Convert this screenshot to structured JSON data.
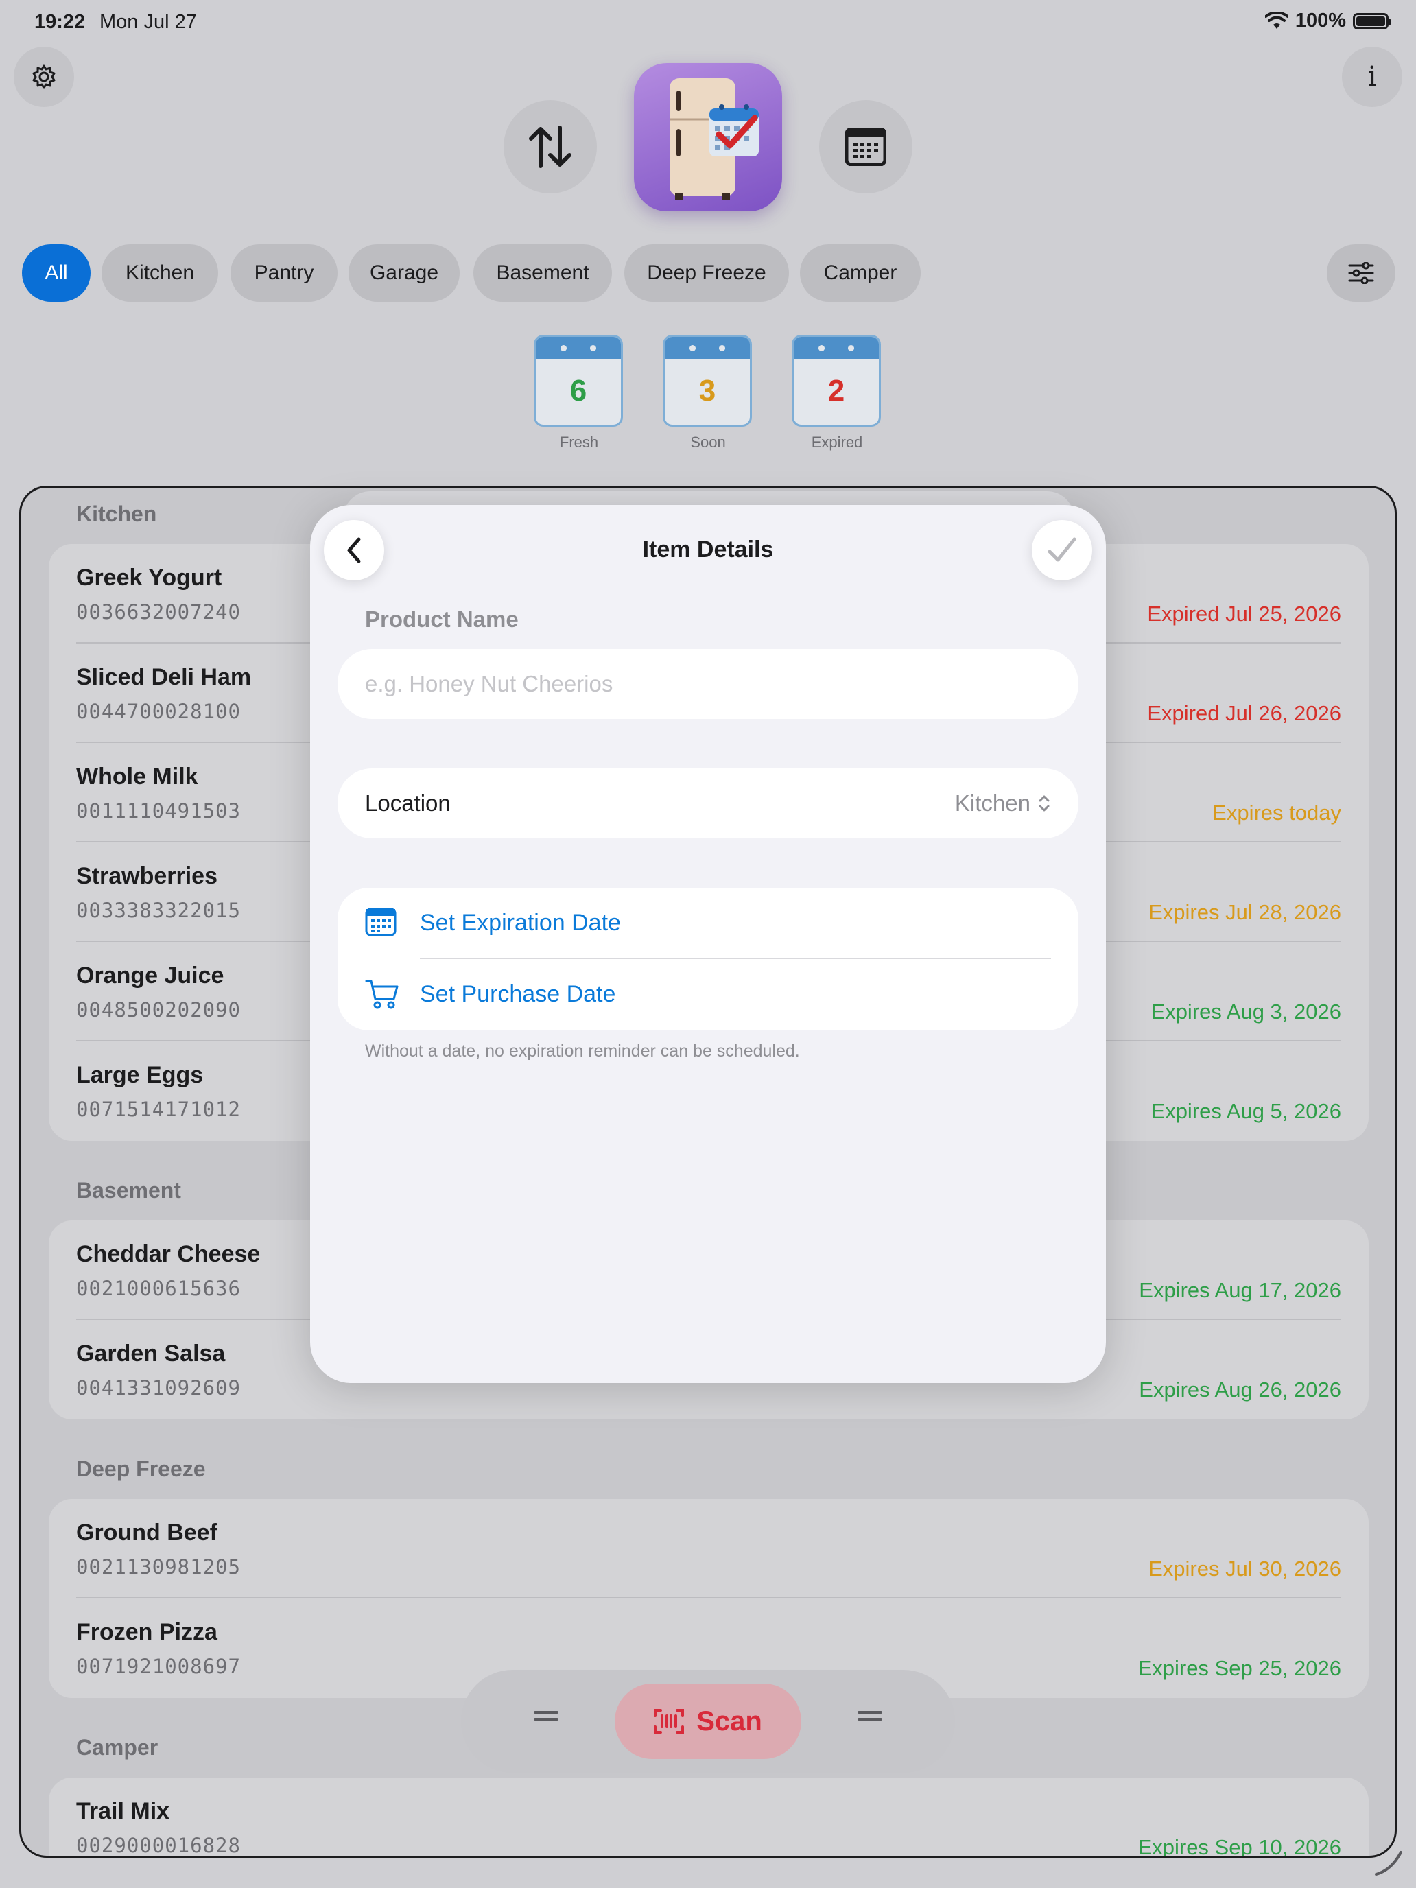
{
  "status": {
    "time": "19:22",
    "date": "Mon Jul 27",
    "battery": "100%"
  },
  "filters": [
    "All",
    "Kitchen",
    "Pantry",
    "Garage",
    "Basement",
    "Deep Freeze",
    "Camper"
  ],
  "stats": [
    {
      "value": "6",
      "label": "Fresh",
      "color": "#2e9e48"
    },
    {
      "value": "3",
      "label": "Soon",
      "color": "#d89a1c"
    },
    {
      "value": "2",
      "label": "Expired",
      "color": "#d6302a"
    }
  ],
  "sections": [
    {
      "title": "Kitchen",
      "items": [
        {
          "name": "Greek Yogurt",
          "code": "0036632007240",
          "expiry": "Expired Jul 25, 2026",
          "status": "red"
        },
        {
          "name": "Sliced Deli Ham",
          "code": "0044700028100",
          "expiry": "Expired Jul 26, 2026",
          "status": "red"
        },
        {
          "name": "Whole Milk",
          "code": "0011110491503",
          "expiry": "Expires today",
          "status": "orange"
        },
        {
          "name": "Strawberries",
          "code": "0033383322015",
          "expiry": "Expires Jul 28, 2026",
          "status": "orange"
        },
        {
          "name": "Orange Juice",
          "code": "0048500202090",
          "expiry": "Expires Aug 3, 2026",
          "status": "green"
        },
        {
          "name": "Large Eggs",
          "code": "0071514171012",
          "expiry": "Expires Aug 5, 2026",
          "status": "green"
        }
      ]
    },
    {
      "title": "Basement",
      "items": [
        {
          "name": "Cheddar Cheese",
          "code": "0021000615636",
          "expiry": "Expires Aug 17, 2026",
          "status": "green"
        },
        {
          "name": "Garden Salsa",
          "code": "0041331092609",
          "expiry": "Expires Aug 26, 2026",
          "status": "green"
        }
      ]
    },
    {
      "title": "Deep Freeze",
      "items": [
        {
          "name": "Ground Beef",
          "code": "0021130981205",
          "expiry": "Expires Jul 30, 2026",
          "status": "orange"
        },
        {
          "name": "Frozen Pizza",
          "code": "0071921008697",
          "expiry": "Expires Sep 25, 2026",
          "status": "green"
        }
      ]
    },
    {
      "title": "Camper",
      "items": [
        {
          "name": "Trail Mix",
          "code": "0029000016828",
          "expiry": "Expires Sep 10, 2026",
          "status": "green"
        }
      ]
    }
  ],
  "toolbar": {
    "scan_label": "Scan"
  },
  "modal": {
    "title": "Item Details",
    "product_label": "Product Name",
    "product_placeholder": "e.g. Honey Nut Cheerios",
    "product_value": "",
    "location_label": "Location",
    "location_value": "Kitchen",
    "set_expiration": "Set Expiration Date",
    "set_purchase": "Set Purchase Date",
    "note": "Without a date, no expiration reminder can be scheduled."
  },
  "colors": {
    "accent": "#0a7ad9",
    "expired": "#d6302a",
    "soon": "#d89a1c",
    "fresh": "#2e9e48"
  }
}
